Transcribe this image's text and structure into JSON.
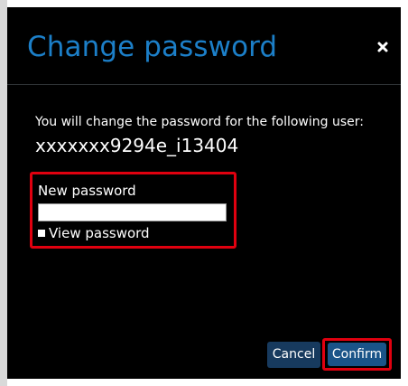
{
  "dialog": {
    "title": "Change password",
    "close_icon": "close-icon"
  },
  "body": {
    "intro": "You will change the password for the following user:",
    "username": "xxxxxxx9294e_i13404"
  },
  "password_field": {
    "label": "New password",
    "value": "",
    "placeholder": ""
  },
  "view_password": {
    "label": "View password",
    "checked": false
  },
  "buttons": {
    "cancel": "Cancel",
    "confirm": "Confirm"
  },
  "colors": {
    "title": "#1c7fc8",
    "background": "#000000",
    "highlight": "#e0000f",
    "button": "#173a5e"
  }
}
